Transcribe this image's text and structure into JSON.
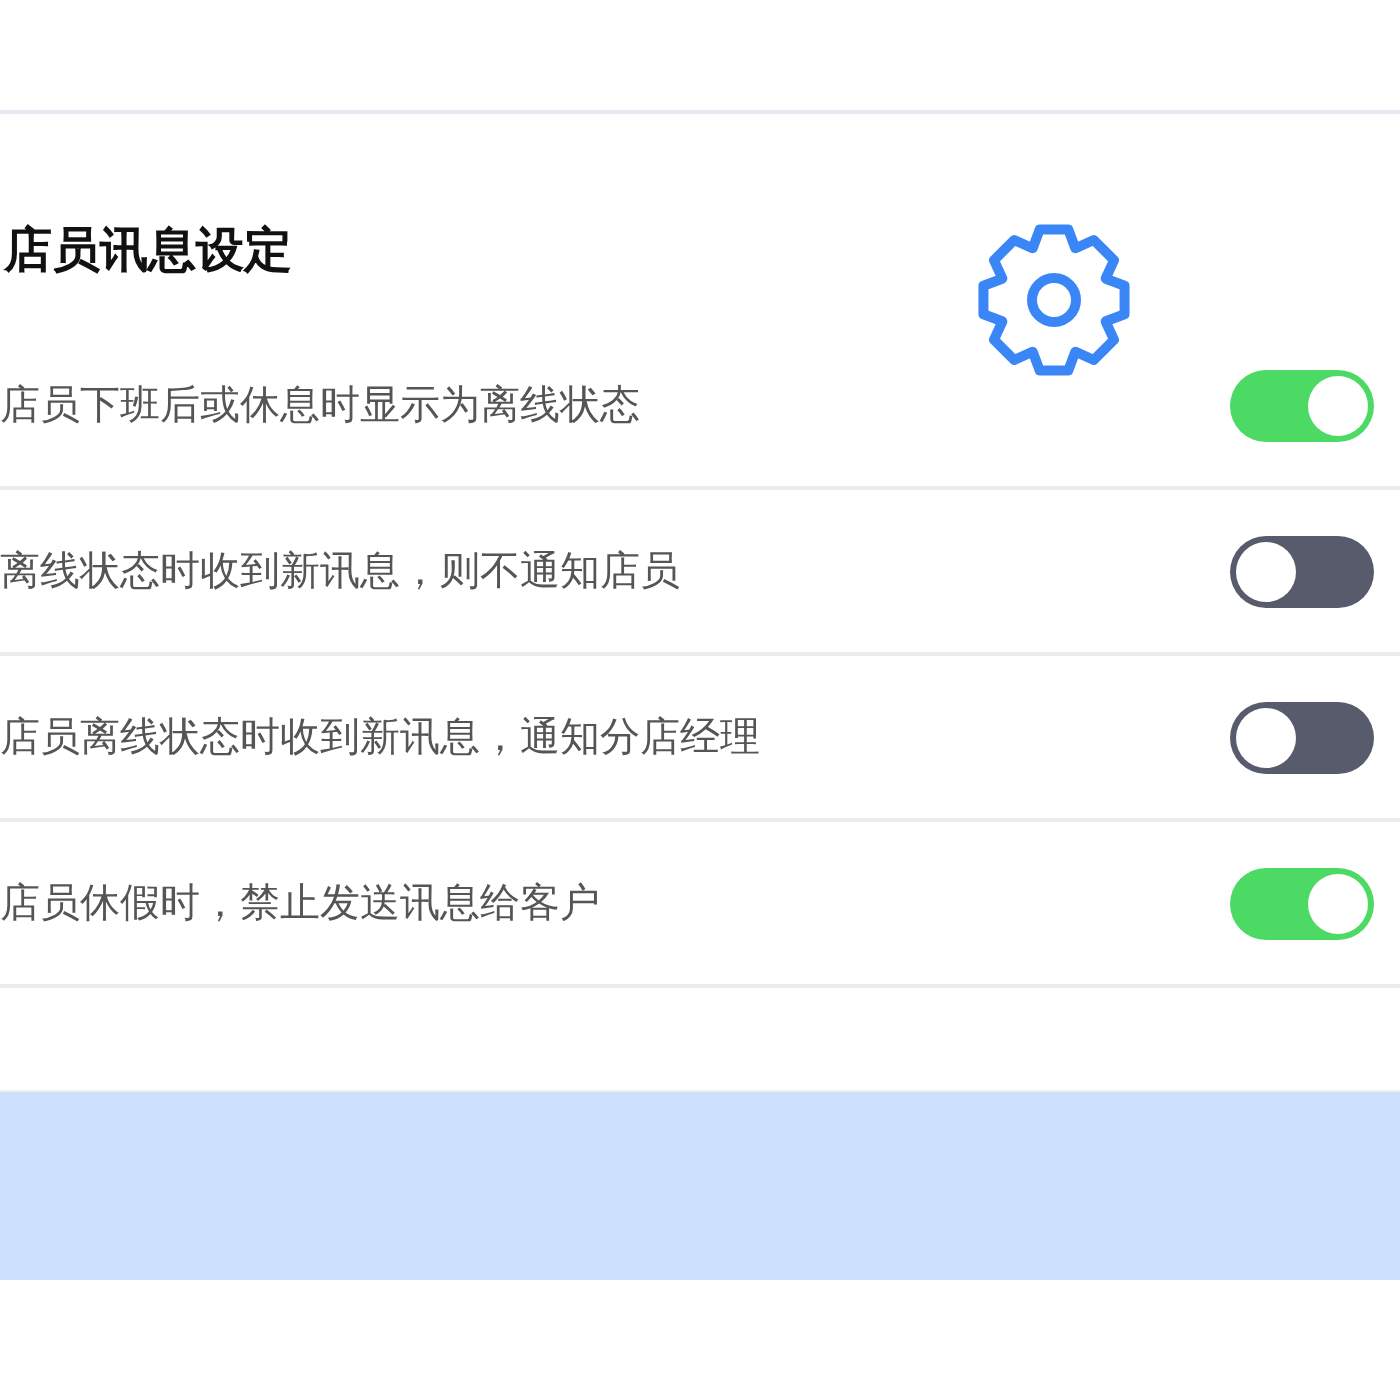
{
  "title": "店员讯息设定",
  "settings": [
    {
      "label": "店员下班后或休息时显示为离线状态",
      "on": true
    },
    {
      "label": "离线状态时收到新讯息，则不通知店员",
      "on": false
    },
    {
      "label": "店员离线状态时收到新讯息，通知分店经理",
      "on": false
    },
    {
      "label": "店员休假时，禁止发送讯息给客户",
      "on": true
    }
  ]
}
